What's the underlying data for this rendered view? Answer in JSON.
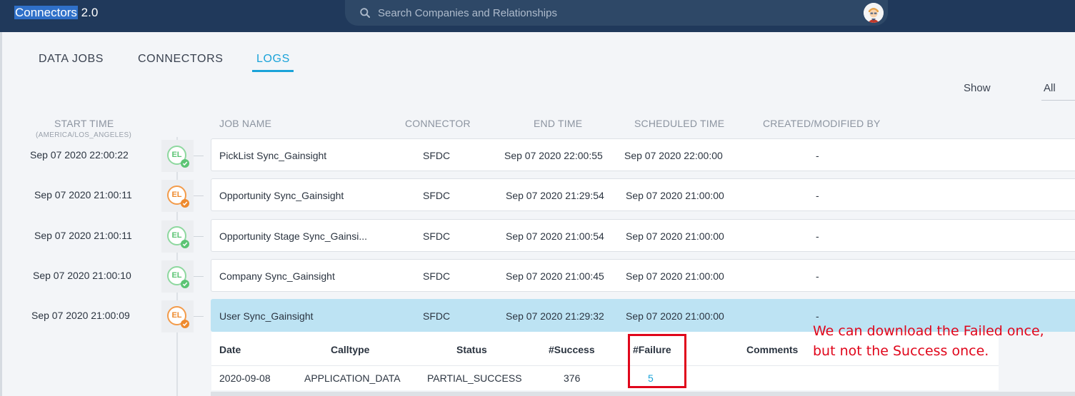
{
  "app": {
    "title_highlight": "Connectors",
    "title_rest": " 2.0"
  },
  "search": {
    "placeholder": "Search Companies and Relationships"
  },
  "tabs": [
    {
      "label": "DATA JOBS",
      "active": false
    },
    {
      "label": "CONNECTORS",
      "active": false
    },
    {
      "label": "LOGS",
      "active": true
    }
  ],
  "filter": {
    "show_label": "Show",
    "show_value": "All"
  },
  "columns": {
    "start_time": "START TIME",
    "start_time_tz": "(AMERICA/LOS_ANGELES)",
    "job_name": "JOB NAME",
    "connector": "CONNECTOR",
    "end_time": "END TIME",
    "scheduled_time": "SCHEDULED TIME",
    "created_by": "CREATED/MODIFIED BY"
  },
  "rows": [
    {
      "start": "Sep 07 2020 22:00:22",
      "badge": "EL",
      "status_color": "green",
      "job": "PickList Sync_Gainsight",
      "connector": "SFDC",
      "end": "Sep 07 2020 22:00:55",
      "scheduled": "Sep 07 2020 22:00:00",
      "created_by": "-"
    },
    {
      "start": "Sep 07 2020 21:00:11",
      "badge": "EL",
      "status_color": "orange",
      "job": "Opportunity Sync_Gainsight",
      "connector": "SFDC",
      "end": "Sep 07 2020 21:29:54",
      "scheduled": "Sep 07 2020 21:00:00",
      "created_by": "-"
    },
    {
      "start": "Sep 07 2020 21:00:11",
      "badge": "EL",
      "status_color": "green",
      "job": "Opportunity Stage Sync_Gainsi...",
      "connector": "SFDC",
      "end": "Sep 07 2020 21:00:54",
      "scheduled": "Sep 07 2020 21:00:00",
      "created_by": "-"
    },
    {
      "start": "Sep 07 2020 21:00:10",
      "badge": "EL",
      "status_color": "green",
      "job": "Company Sync_Gainsight",
      "connector": "SFDC",
      "end": "Sep 07 2020 21:00:45",
      "scheduled": "Sep 07 2020 21:00:00",
      "created_by": "-"
    },
    {
      "start": "Sep 07 2020 21:00:09",
      "badge": "EL",
      "status_color": "orange",
      "job": "User Sync_Gainsight",
      "connector": "SFDC",
      "end": "Sep 07 2020 21:29:32",
      "scheduled": "Sep 07 2020 21:00:00",
      "created_by": "-"
    }
  ],
  "details": {
    "headers": [
      "Date",
      "Calltype",
      "Status",
      "#Success",
      "#Failure",
      "Comments"
    ],
    "row": {
      "date": "2020-09-08",
      "calltype": "APPLICATION_DATA",
      "status": "PARTIAL_SUCCESS",
      "success": "376",
      "failure": "5",
      "comments": ""
    }
  },
  "annotation": {
    "line1": "We can download the Failed once,",
    "line2": "but not the Success once."
  },
  "colors": {
    "header_bg": "#20395b",
    "accent": "#1aa3d9",
    "success": "#5cc474",
    "partial": "#ee8a2e",
    "selected_row": "#bde3f3",
    "annotation": "#e0061b"
  }
}
